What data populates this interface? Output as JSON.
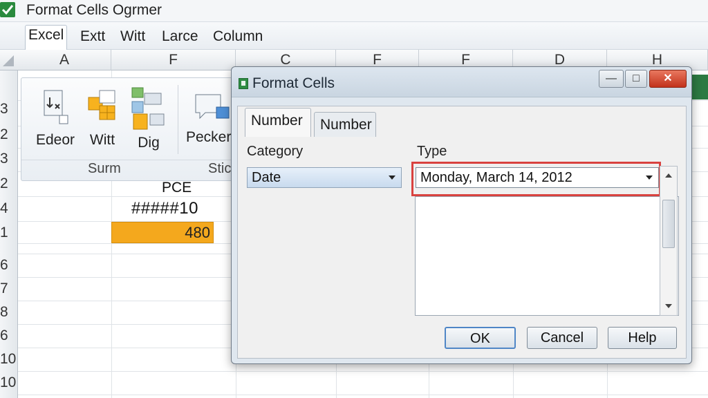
{
  "app": {
    "title": "Format Cells  Ogrmer"
  },
  "menu": {
    "items": [
      "Excel",
      "Extt",
      "Witt",
      "Larce",
      "Column"
    ]
  },
  "columns": {
    "headers": [
      "A",
      "F",
      "C",
      "F",
      "F",
      "D",
      "H"
    ]
  },
  "rows": {
    "headers": [
      "3",
      "2",
      "3",
      "2",
      "4",
      "1",
      "6",
      "7",
      "8",
      "6",
      "10",
      "10"
    ]
  },
  "ribbon": {
    "buttons": [
      "Edeor",
      "Witt",
      "Dig",
      "Pecker"
    ],
    "groups": [
      "Surm",
      "Stic"
    ]
  },
  "cells": {
    "header": "PCE",
    "overflow": "#####10",
    "value": "480"
  },
  "colors": {
    "accent_cell": "#f4a81d",
    "highlight": "#d9423f",
    "title_green": "#2c7a42"
  },
  "dialog": {
    "title": "Format Cells",
    "tabs": [
      "Number",
      "Number"
    ],
    "category_label": "Category",
    "category_value": "Date",
    "type_label": "Type",
    "type_value": "Monday, March 14, 2012",
    "buttons": {
      "ok": "OK",
      "cancel": "Cancel",
      "help": "Help"
    }
  }
}
